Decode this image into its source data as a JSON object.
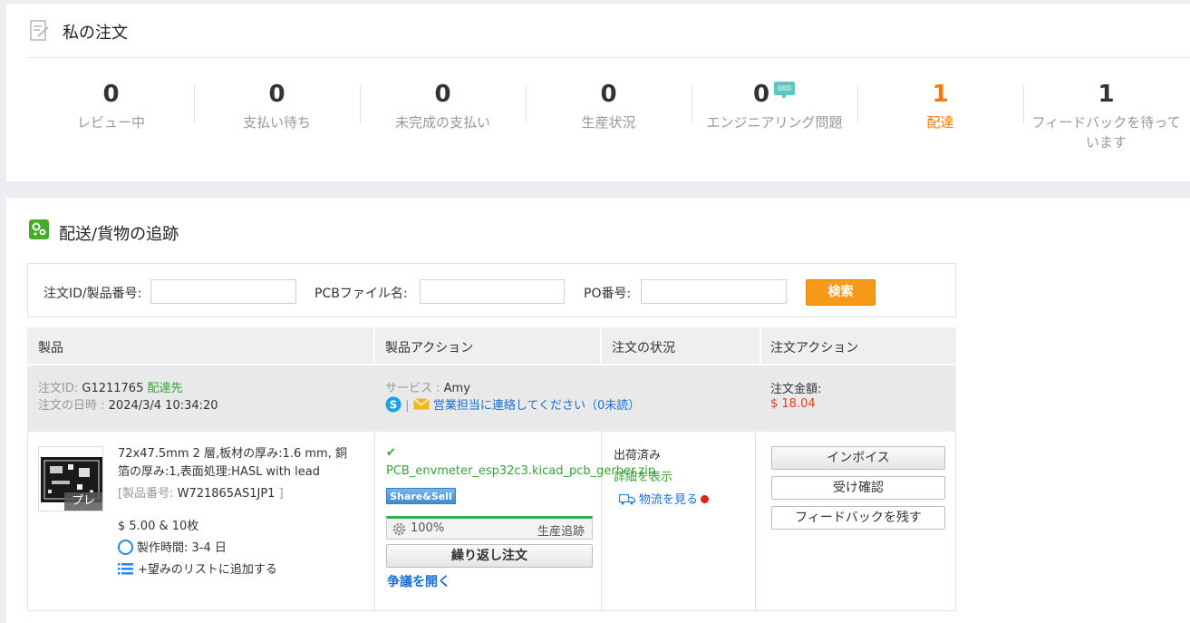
{
  "my_orders": {
    "title": "私の注文",
    "stats": [
      {
        "count": "0",
        "label": "レビュー中"
      },
      {
        "count": "0",
        "label": "支払い待ち"
      },
      {
        "count": "0",
        "label": "未完成の支払い"
      },
      {
        "count": "0",
        "label": "生産状況"
      },
      {
        "count": "0",
        "label": "エンジニアリング問題"
      },
      {
        "count": "1",
        "label": "配達"
      },
      {
        "count": "1",
        "label": "フィードバックを待っています"
      }
    ],
    "active_color": "#f27b07"
  },
  "tracking": {
    "title": "配送/貨物の追跡",
    "search": {
      "order_label": "注文ID/製品番号:",
      "order_value": "",
      "pcb_label": "PCBファイル名:",
      "pcb_value": "",
      "po_label": "PO番号:",
      "po_value": "",
      "button": "検索"
    },
    "columns": [
      "製品",
      "製品アクション",
      "注文の状況",
      "注文アクション"
    ]
  },
  "order": {
    "id_label": "注文ID:",
    "id": "G1211765",
    "delivery_link": "配達先",
    "date_label": "注文の日時 :",
    "date": "2024/3/4 10:34:20",
    "service_label": "サービス :",
    "service_name": "Amy",
    "contact_link": "営業担当に連絡してください（0未読）",
    "amount_label": "注文金額:",
    "amount": "$ 18.04",
    "item": {
      "thumb_tag": "プレ",
      "description": "72x47.5mm 2 層,板材の厚み:1.6 mm, 銅箔の厚み:1,表面処理:HASL with lead",
      "pn_label": "[製品番号:",
      "pn": "W721865AS1JP1",
      "pn_close": "]",
      "price_qty": "$ 5.00 & 10枚",
      "lead_time": "製作時間: 3-4 日",
      "wishlist": "+望みのリストに追加する",
      "file": "PCB_envmeter_esp32c3.kicad_pcb_gerber.zip",
      "share": "Share&Sell",
      "progress": "100%",
      "progress_value": 1.0,
      "track_production": "生産追跡",
      "reorder": "繰り返し注文",
      "dispute": "争議を開く",
      "status": "出荷済み",
      "details": "詳細を表示",
      "logistics": "物流を見る",
      "invoice": "インボイス",
      "confirm": "受け確認",
      "feedback": "フィードバックを残す"
    }
  }
}
